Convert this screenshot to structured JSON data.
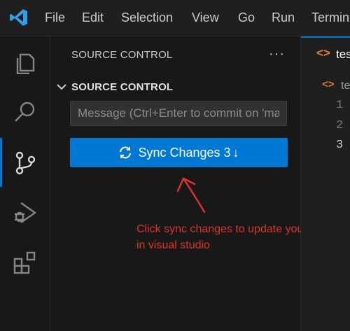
{
  "menu": [
    "File",
    "Edit",
    "Selection",
    "View",
    "Go",
    "Run",
    "Termin"
  ],
  "sidebar": {
    "title": "SOURCE CONTROL",
    "more_label": "···",
    "section_label": "SOURCE CONTROL",
    "message_placeholder": "Message (Ctrl+Enter to commit on 'main')",
    "sync_button": {
      "label": "Sync Changes 3",
      "arrow": "↓"
    }
  },
  "annotation": {
    "text": "Click sync changes to update your code in visual studio"
  },
  "editor": {
    "tab_icon": "<>",
    "tab_label": "tes",
    "breadcrumb_icon": "<>",
    "breadcrumb_label": "te",
    "line_numbers": [
      "1",
      "2",
      "3"
    ],
    "current_line": "3"
  },
  "colors": {
    "accent": "#0078d4",
    "annotation": "#d9342b",
    "html_icon": "#e37933"
  },
  "icons": [
    "vscode-logo-icon",
    "explorer-icon",
    "search-icon",
    "source-control-icon",
    "run-debug-icon",
    "extensions-icon",
    "sync-icon",
    "chevron-down-icon",
    "red-arrow-icon"
  ]
}
